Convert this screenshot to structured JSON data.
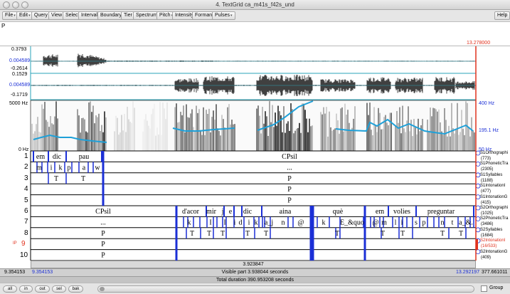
{
  "window": {
    "title": "4. TextGrid ca_m41s_f42s_und"
  },
  "menu": [
    {
      "label": "File",
      "w": 20
    },
    {
      "label": "Edit",
      "w": 21
    },
    {
      "label": "Query",
      "w": 24
    },
    {
      "label": "View",
      "w": 20
    },
    {
      "label": "Select",
      "w": 22
    },
    {
      "label": "Interval",
      "w": 27
    },
    {
      "label": "Boundary",
      "w": 33
    },
    {
      "label": "Tier",
      "w": 17
    },
    {
      "label": "Spectrum",
      "w": 33
    },
    {
      "label": "Pitch",
      "w": 22
    },
    {
      "label": "Intensity",
      "w": 28
    },
    {
      "label": "Formant",
      "w": 28
    },
    {
      "label": "Pulses",
      "w": 26
    }
  ],
  "help_label": "Help",
  "text_field": {
    "value": "P"
  },
  "time_top_right": "13.278000",
  "waveform": {
    "ch1_max": "0.3793",
    "ch1_mid": "0.004589",
    "ch1_min": "-0.2614",
    "ch2_max": "0.1529",
    "ch2_mid": "0.004589",
    "ch2_min": "-0.1719"
  },
  "spectrogram": {
    "fmax": "5000 Hz",
    "fmin": "0 Hz",
    "pitch_max": "400 Hz",
    "pitch_cur": "195.1 Hz",
    "pitch_min": "50 Hz"
  },
  "tiers": [
    {
      "num": "1",
      "name": "S1Orthographi",
      "count": "(773)"
    },
    {
      "num": "2",
      "name": "S1PhoneticTra",
      "count": "(2305)"
    },
    {
      "num": "3",
      "name": "S1Syllables",
      "count": "(1188)"
    },
    {
      "num": "4",
      "name": "S1IntonationI",
      "count": "(477)"
    },
    {
      "num": "5",
      "name": "S1IntonationG",
      "count": "(415)"
    },
    {
      "num": "6",
      "name": "S2Orthographi",
      "count": "(1025)"
    },
    {
      "num": "7",
      "name": "S2PhoneticTra",
      "count": "(3486)"
    },
    {
      "num": "8",
      "name": "S2Syllables",
      "count": "(1684)"
    },
    {
      "num": "9",
      "name": "S2IntonationI",
      "count": "(16/533)",
      "prefix": "IP",
      "selected": true
    },
    {
      "num": "10",
      "name": "S2IntonationG",
      "count": "(409)"
    }
  ],
  "intervals": {
    "t1": [
      "em",
      "dic",
      "pau",
      "CPsil"
    ],
    "t2": [
      "m",
      "i",
      "k",
      "p",
      "a",
      "w",
      "..."
    ],
    "t3": [
      "T",
      "T",
      "P"
    ],
    "t4": [
      "P"
    ],
    "t5": [
      "P"
    ],
    "t6": [
      "CPsil",
      "d'acor",
      "mir",
      "j",
      "e",
      "dic",
      "aina",
      "què",
      "em",
      "volies",
      "preguntar"
    ],
    "t7": [
      "...",
      "k",
      "I",
      "I",
      "i",
      "d",
      "i",
      "k",
      "a_j",
      "n",
      "@",
      "k",
      "E_&quo",
      "@",
      "m",
      "l",
      "i",
      "s",
      "p",
      "n",
      "t",
      "a_&."
    ],
    "t8": [
      "P",
      "T",
      "T",
      "T",
      "T",
      "T",
      "T",
      "T",
      "T",
      "T",
      "T"
    ],
    "t9": [
      "P"
    ],
    "t10": [
      "P"
    ]
  },
  "selection_duration": "3.923847",
  "status": {
    "left_time": "9.354153",
    "visible_start": "9.354153",
    "visible_part": "Visible part 3.938044 seconds",
    "visible_end": "13.292197",
    "right_time": "377.661011",
    "total_duration": "Total duration 390.953208 seconds"
  },
  "nav": [
    "all",
    "in",
    "out",
    "sel",
    "bak"
  ],
  "group_label": "Group",
  "colors": {
    "accent": "#1b2fd6",
    "pitch": "#1ea0d8",
    "cyan": "#29a3b8",
    "selection": "#e0321e"
  }
}
